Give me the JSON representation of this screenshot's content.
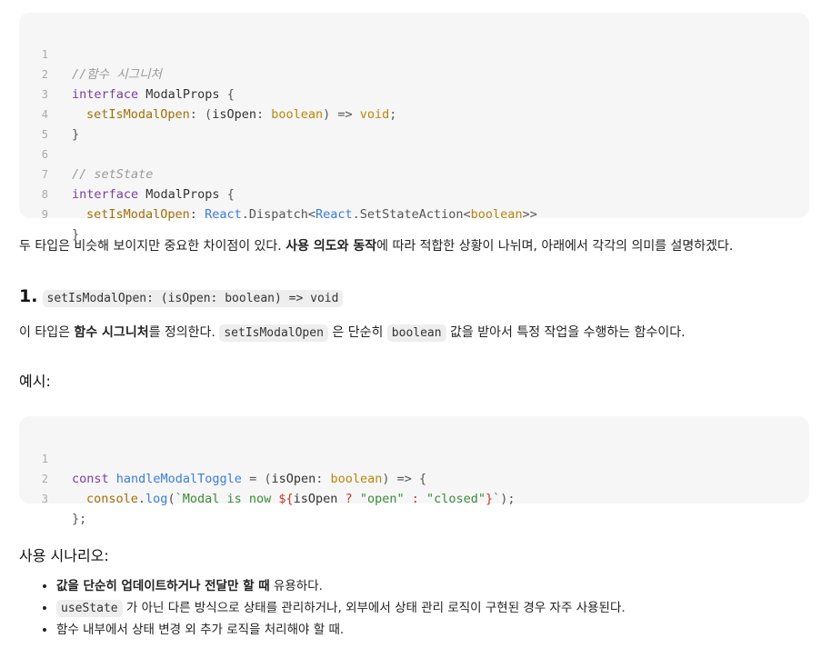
{
  "code_block_1": {
    "lines": [
      {
        "n": "1",
        "comment": "//함수 시그니처"
      },
      {
        "n": "2",
        "kw": "interface",
        "name": " ModalProps ",
        "punc": "{"
      },
      {
        "n": "3",
        "prop": "setIsModalOpen",
        "p1": ": (",
        "arg": "isOpen",
        "p2": ": ",
        "type": "boolean",
        "p3": ") => ",
        "ret": "void",
        "p4": ";"
      },
      {
        "n": "4",
        "punc": "}"
      },
      {
        "n": "5"
      },
      {
        "n": "6",
        "comment": "// setState"
      },
      {
        "n": "7",
        "kw": "interface",
        "name": " ModalProps ",
        "punc": "{"
      },
      {
        "n": "8",
        "prop": "setIsModalOpen",
        "p1": ": ",
        "react1": "React",
        "p2": ".Dispatch<",
        "react2": "React",
        "p3": ".SetStateAction<",
        "type": "boolean",
        "p4": ">>"
      },
      {
        "n": "9",
        "punc": "}"
      }
    ]
  },
  "intro": {
    "pre": "두 타입은 비슷해 보이지만 중요한 차이점이 있다. ",
    "bold": "사용 의도와 동작",
    "post": "에 따라 적합한 상황이 나뉘며, 아래에서 각각의 의미를 설명하겠다."
  },
  "section1": {
    "number": "1.",
    "code": "setIsModalOpen: (isOpen: boolean) => void"
  },
  "section1_desc": {
    "pre": "이 타입은 ",
    "bold": "함수 시그니처",
    "mid1": "를 정의한다. ",
    "code1": "setIsModalOpen",
    "mid2": " 은 단순히 ",
    "code2": "boolean",
    "post": " 값을 받아서 특정 작업을 수행하는 함수이다."
  },
  "example_label": "예시:",
  "code_block_2": {
    "l1": {
      "n": "1",
      "kw": "const",
      "fn": " handleModalToggle",
      "p1": " = (",
      "arg": "isOpen",
      "p2": ": ",
      "type": "boolean",
      "p3": ") => {"
    },
    "l2": {
      "n": "2",
      "obj": "console",
      "p1": ".",
      "fn": "log",
      "p2": "(",
      "str1": "`Modal is now ",
      "interp1": "${",
      "arg": "isOpen",
      "op": " ? ",
      "str2": "\"open\"",
      "op2": " : ",
      "str3": "\"closed\"",
      "interp2": "}",
      "str4": "`",
      "p3": ");"
    },
    "l3": {
      "n": "3",
      "p1": "};"
    }
  },
  "scenario_label": "사용 시나리오:",
  "bullets": {
    "b1_bold": "값을 단순히 업데이트하거나 전달만 할 때",
    "b1_post": " 유용하다.",
    "b2_code": "useState",
    "b2_post": " 가 아닌 다른 방식으로 상태를 관리하거나, 외부에서 상태 관리 로직이 구현된 경우 자주 사용된다.",
    "b3": "함수 내부에서 상태 변경 외 추가 로직을 처리해야 할 때."
  }
}
